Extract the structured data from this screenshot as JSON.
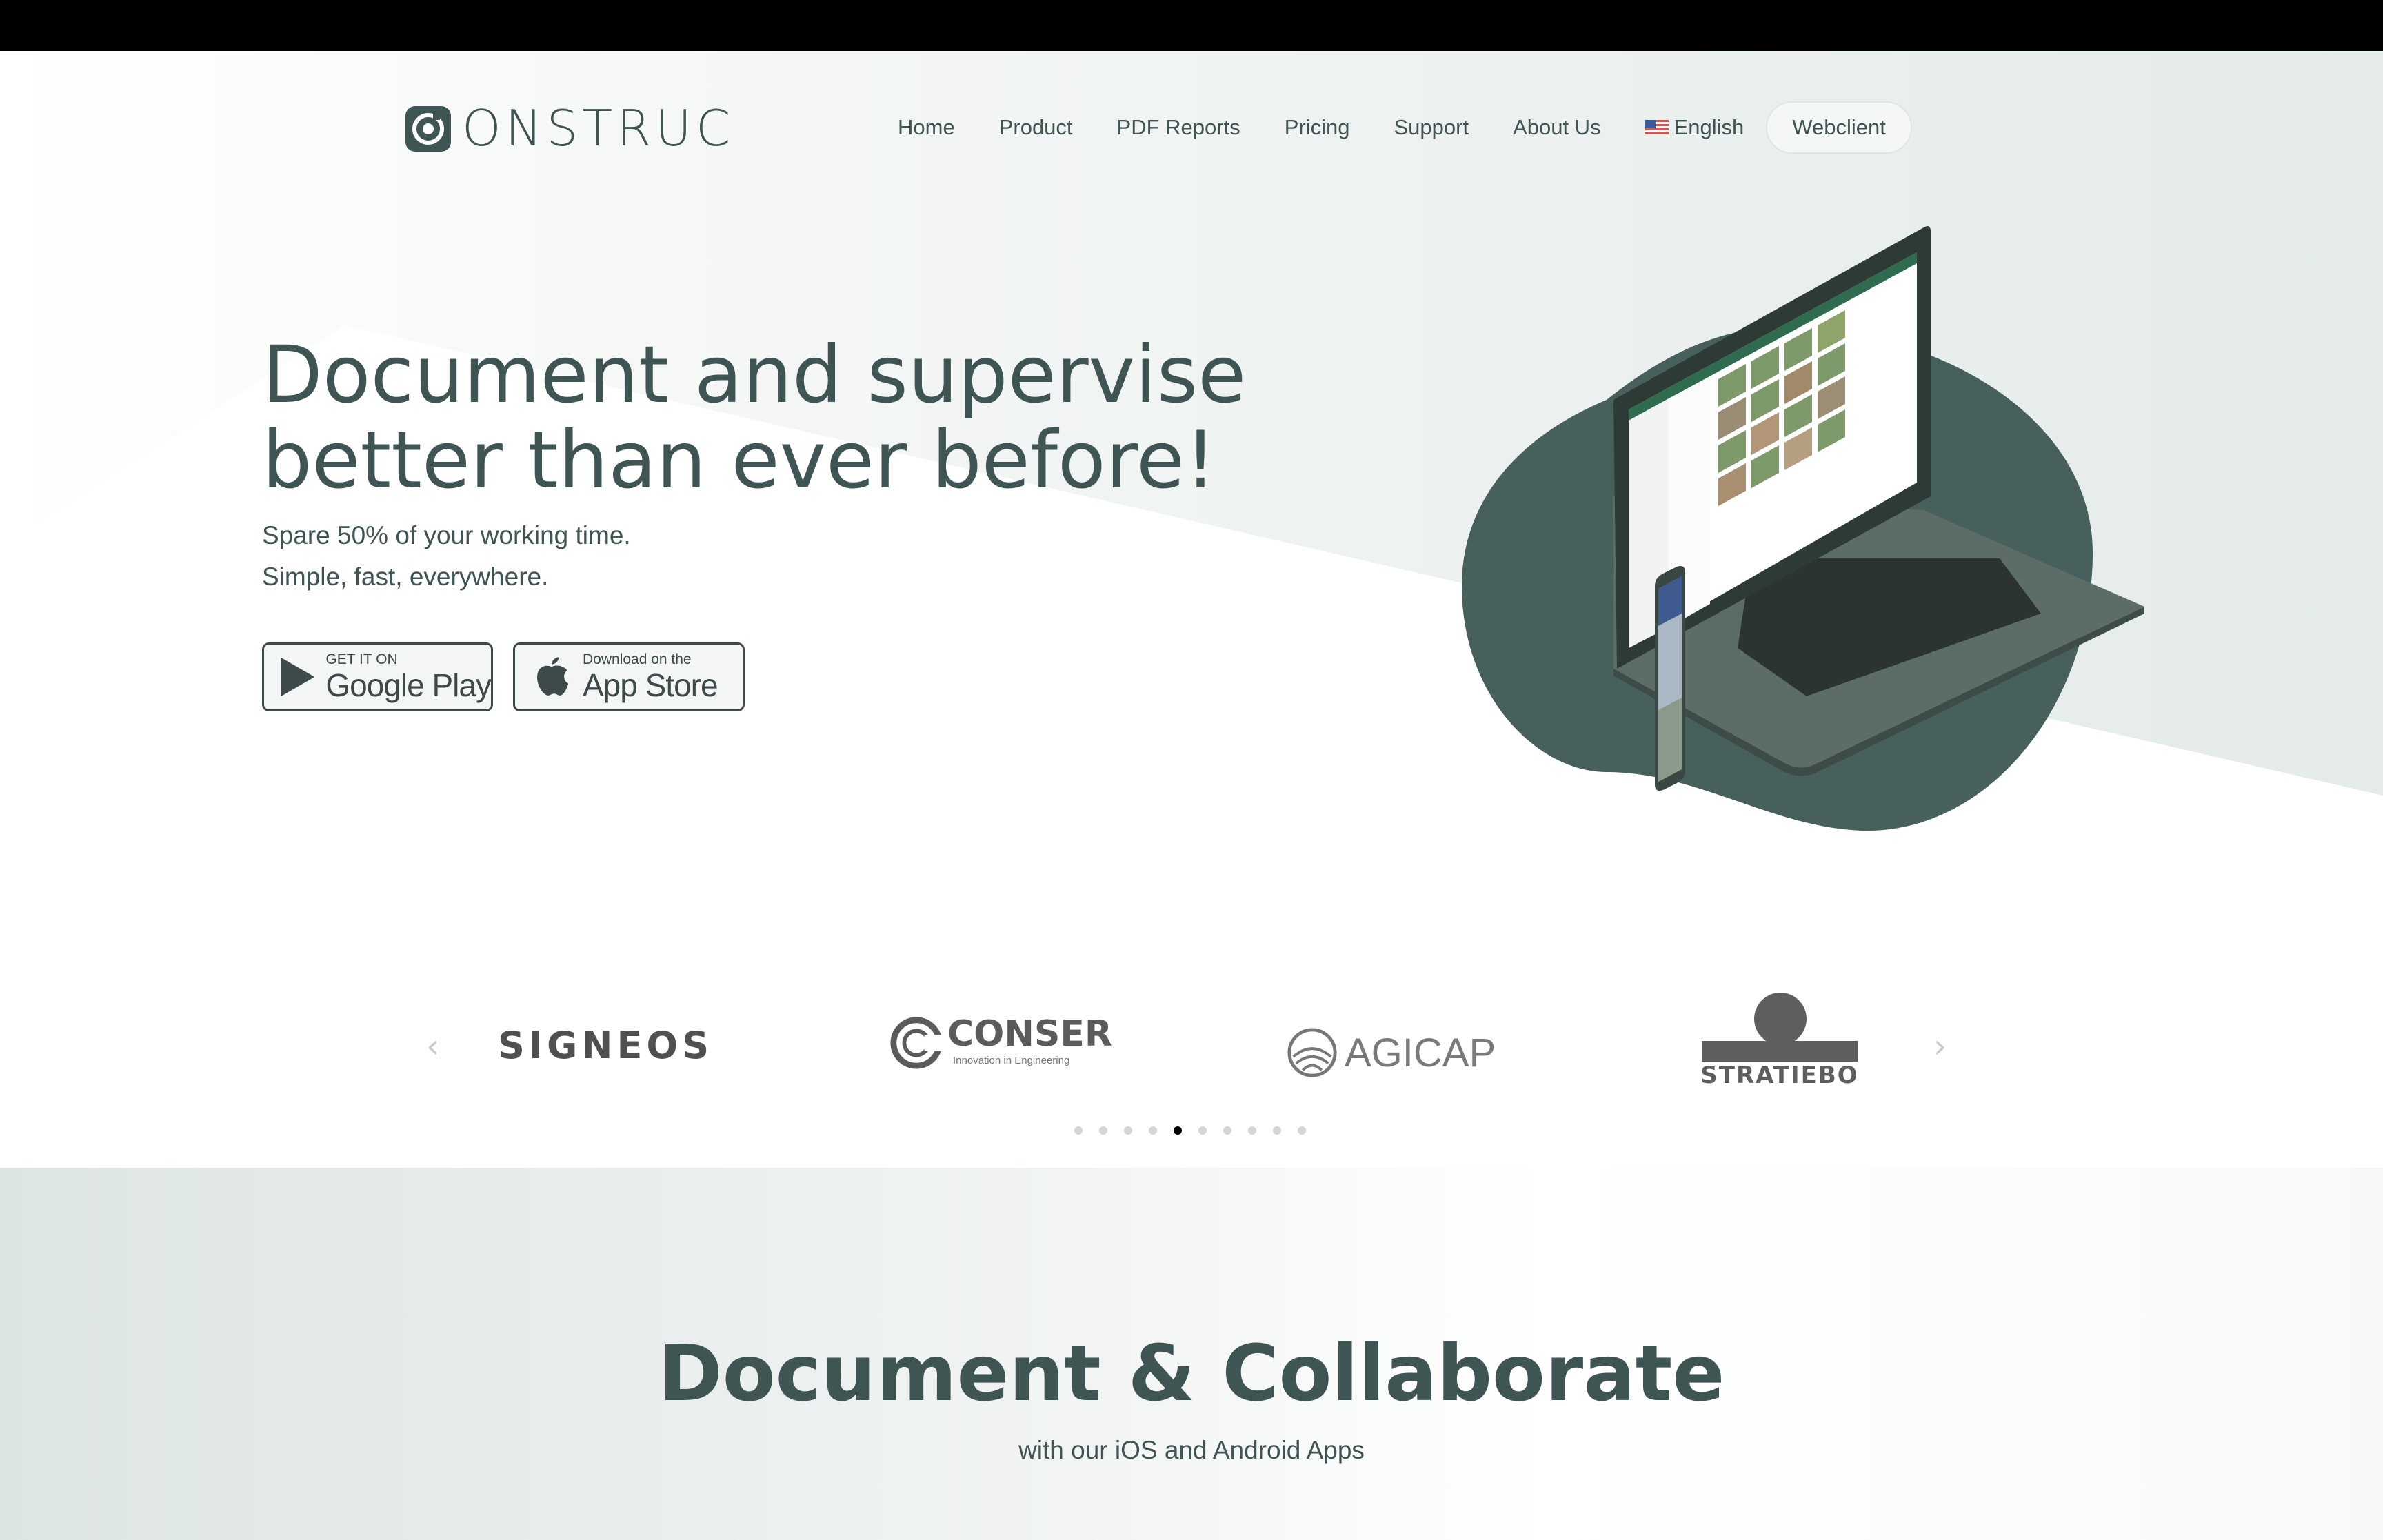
{
  "brand": {
    "name": "ONSTRUC"
  },
  "nav": {
    "items": [
      {
        "label": "Home"
      },
      {
        "label": "Product"
      },
      {
        "label": "PDF Reports"
      },
      {
        "label": "Pricing"
      },
      {
        "label": "Support"
      },
      {
        "label": "About Us"
      }
    ],
    "language": "English",
    "cta": "Webclient"
  },
  "hero": {
    "headline_line1": "Document and supervise",
    "headline_line2": "better than ever before!",
    "subline1": "Spare 50% of your working time.",
    "subline2": "Simple, fast, everywhere.",
    "google_play": {
      "small": "GET IT ON",
      "big": "Google Play"
    },
    "app_store": {
      "small": "Download on the",
      "big": "App Store"
    }
  },
  "partners": {
    "logos": [
      {
        "name": "SIGNEOS"
      },
      {
        "name": "CONSER",
        "tagline": "Innovation in Engineering"
      },
      {
        "name": "AGICAP"
      },
      {
        "name": "STRATIEBO"
      }
    ],
    "dot_count": 10,
    "active_dot": 4
  },
  "section2": {
    "title": "Document & Collaborate",
    "subtitle": "with our iOS and Android Apps"
  },
  "colors": {
    "primary": "#3f5553",
    "blob": "#48605b",
    "laptop": "#5a6b65"
  }
}
